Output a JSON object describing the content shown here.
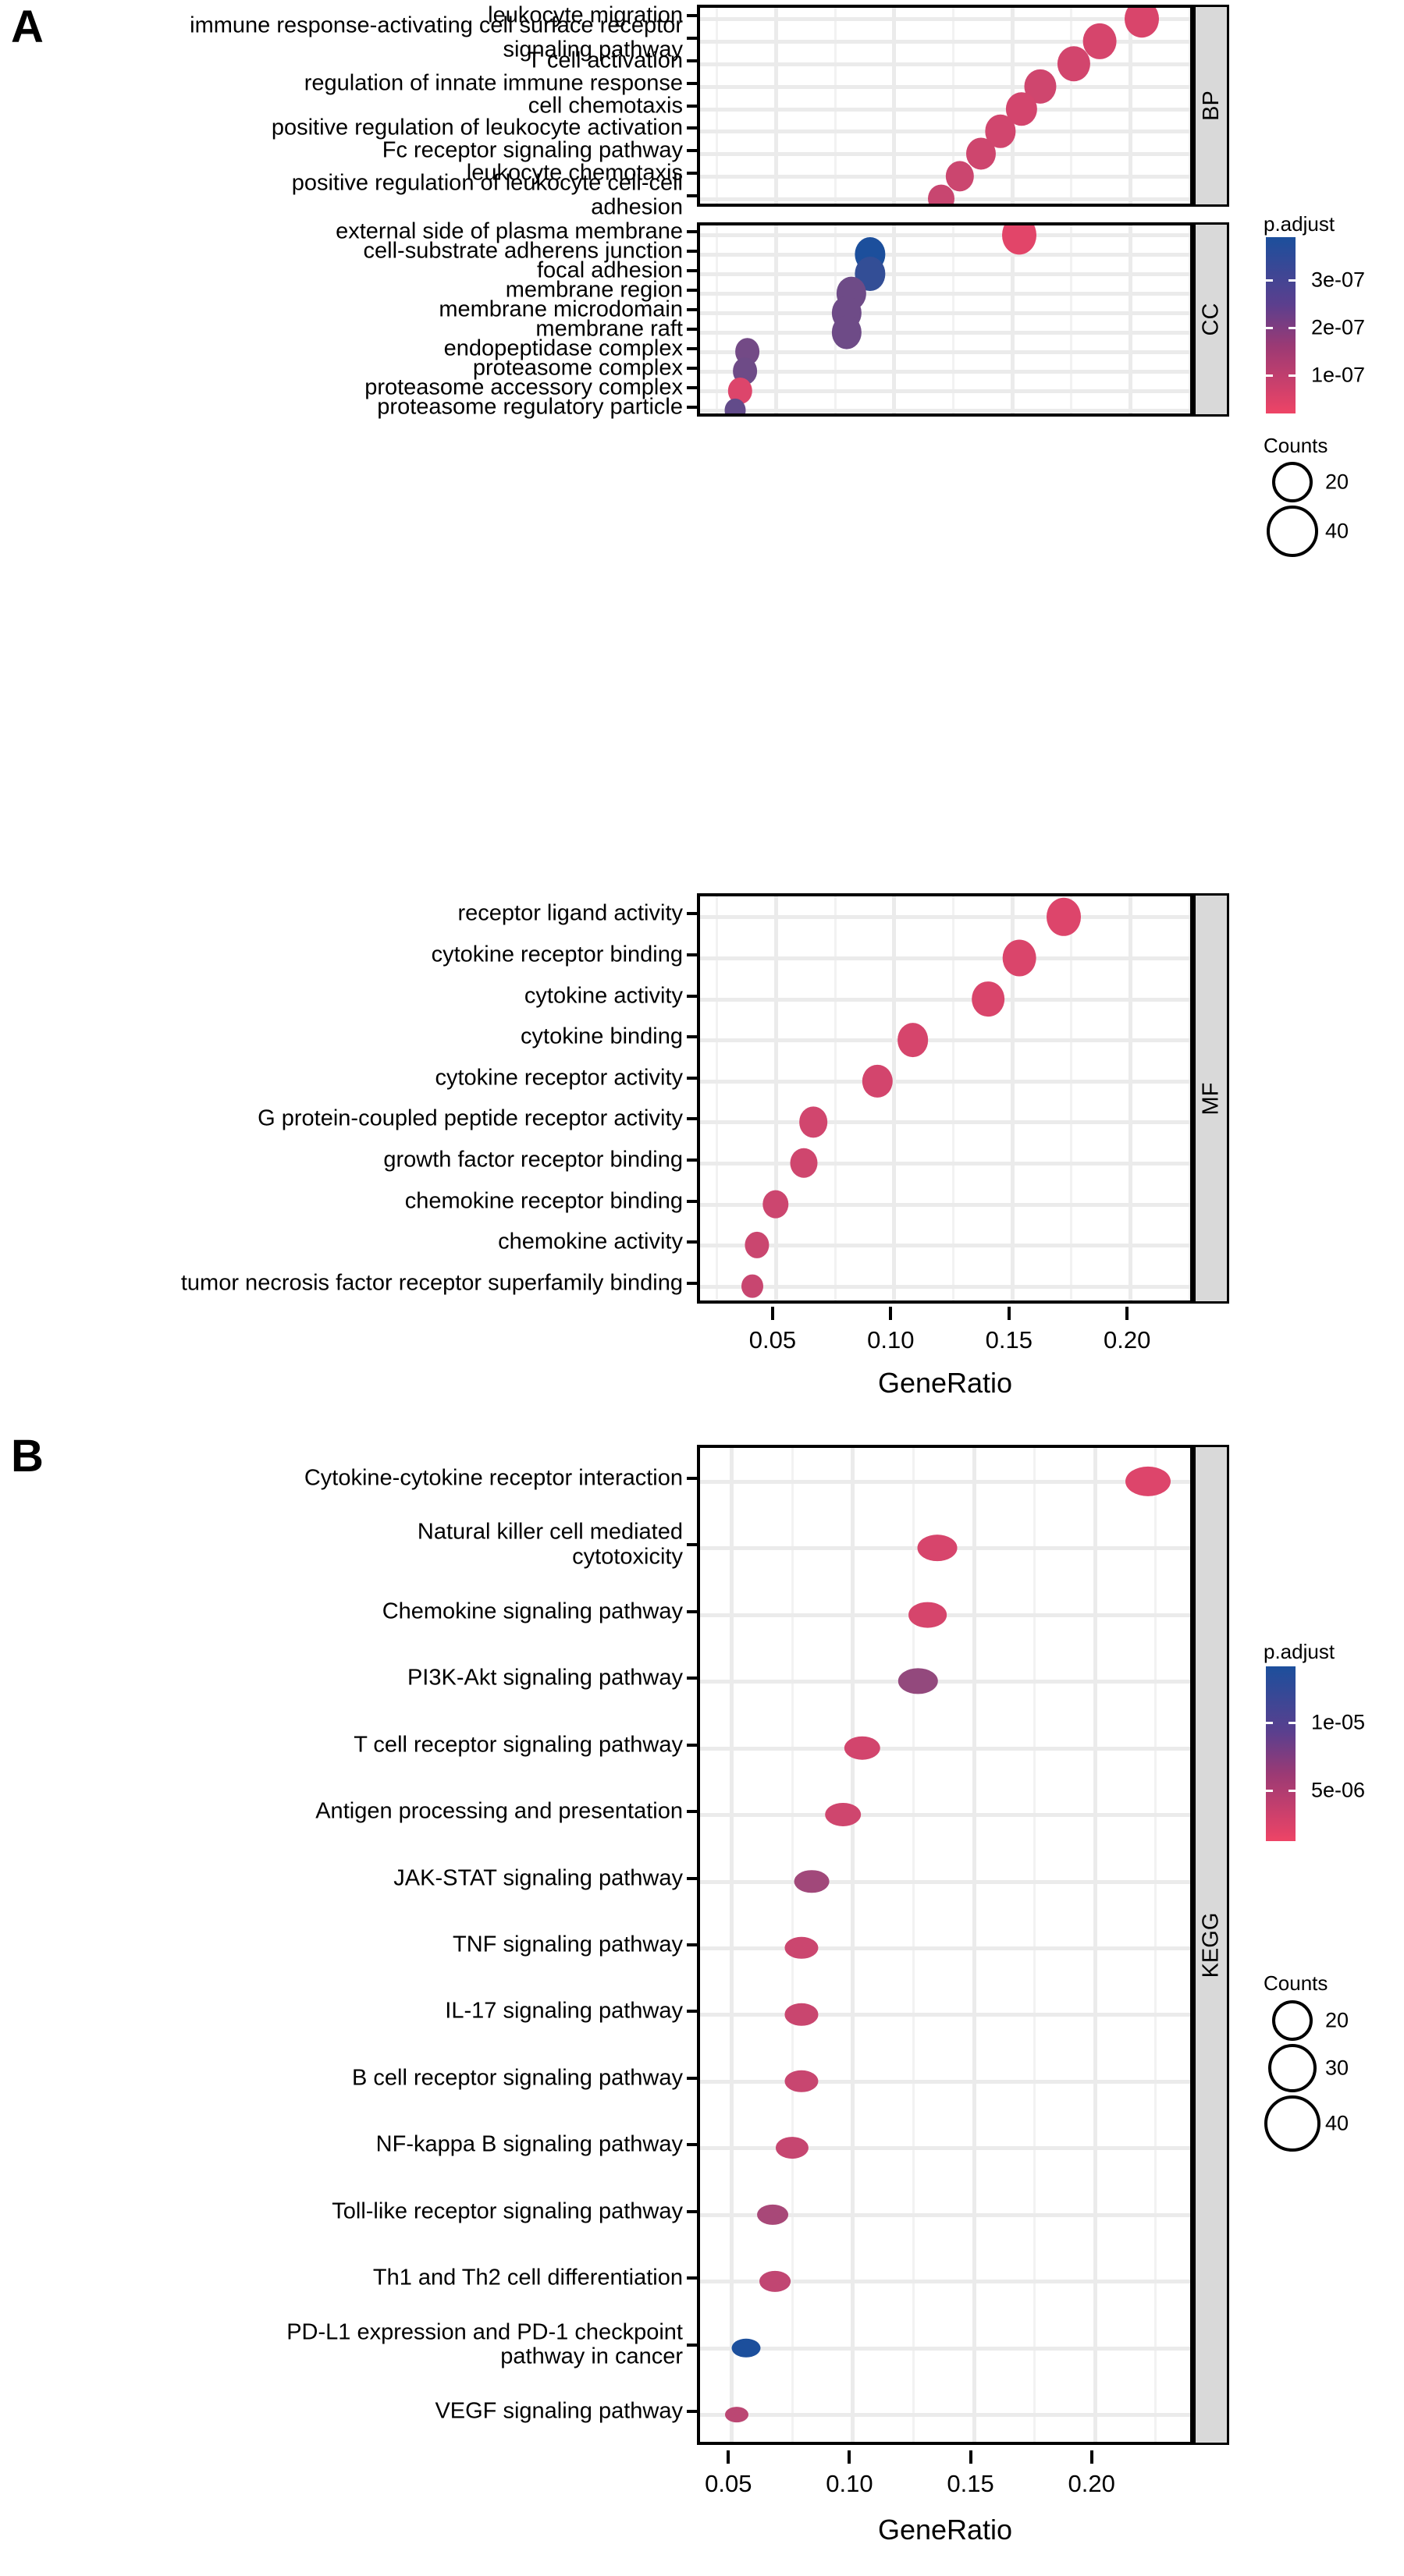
{
  "figure": {
    "panels": [
      {
        "letter": "A"
      },
      {
        "letter": "B"
      }
    ]
  },
  "panelA": {
    "letter": "A",
    "axis": {
      "xlabel": "GeneRatio",
      "xticks": [
        "0.05",
        "0.10",
        "0.15",
        "0.20"
      ],
      "xtick_values": [
        0.05,
        0.1,
        0.15,
        0.2
      ],
      "xlim": [
        0.018,
        0.228
      ]
    },
    "facets": [
      {
        "strip": "BP"
      },
      {
        "strip": "CC"
      },
      {
        "strip": "MF"
      }
    ],
    "legend": {
      "color_title": "p.adjust",
      "color_labels": [
        "3e-07",
        "2e-07",
        "1e-07"
      ],
      "color_values": [
        3e-07,
        2e-07,
        1e-07
      ],
      "color_low": "#ee4466",
      "color_high": "#1c4f9c",
      "size_title": "Counts",
      "size_labels": [
        "20",
        "40"
      ],
      "size_values": [
        20,
        40
      ]
    }
  },
  "panelB": {
    "letter": "B",
    "axis": {
      "xlabel": "GeneRatio",
      "xticks": [
        "0.05",
        "0.10",
        "0.15",
        "0.20"
      ],
      "xtick_values": [
        0.05,
        0.1,
        0.15,
        0.2
      ],
      "xlim": [
        0.037,
        0.242
      ]
    },
    "facets": [
      {
        "strip": "KEGG"
      }
    ],
    "legend": {
      "color_title": "p.adjust",
      "color_labels": [
        "1e-05",
        "5e-06"
      ],
      "color_values": [
        1e-05,
        5e-06
      ],
      "color_low": "#ee4466",
      "color_high": "#1c4f9c",
      "size_title": "Counts",
      "size_labels": [
        "20",
        "30",
        "40"
      ],
      "size_values": [
        20,
        30,
        40
      ]
    }
  },
  "chart_data": [
    {
      "type": "scatter",
      "id": "GO-BP",
      "title": "",
      "facet": "BP",
      "xlabel": "GeneRatio",
      "ylabel": "",
      "xlim": [
        0.018,
        0.228
      ],
      "grid": true,
      "color_scale": {
        "name": "p.adjust",
        "low": "#ee4466",
        "high": "#1c4f9c",
        "ticks": [
          1e-07,
          2e-07,
          3e-07
        ]
      },
      "size_scale": {
        "name": "Counts",
        "ticks": [
          20,
          40
        ]
      },
      "points": [
        {
          "label": "leukocyte migration",
          "x": 0.205,
          "count": 44,
          "p.adjust": 3e-08
        },
        {
          "label": "immune response-activating cell surface receptor\nsignaling pathway",
          "x": 0.187,
          "count": 40,
          "p.adjust": 3.5e-08
        },
        {
          "label": "T cell activation",
          "x": 0.176,
          "count": 38,
          "p.adjust": 4e-08
        },
        {
          "label": "regulation of innate immune response",
          "x": 0.162,
          "count": 35,
          "p.adjust": 4.5e-08
        },
        {
          "label": "cell chemotaxis",
          "x": 0.154,
          "count": 33,
          "p.adjust": 3.8e-08
        },
        {
          "label": "positive regulation of leukocyte activation",
          "x": 0.145,
          "count": 31,
          "p.adjust": 4.2e-08
        },
        {
          "label": "Fc receptor signaling pathway",
          "x": 0.137,
          "count": 29,
          "p.adjust": 4.6e-08
        },
        {
          "label": "leukocyte chemotaxis",
          "x": 0.128,
          "count": 27,
          "p.adjust": 5e-08
        },
        {
          "label": "positive regulation of leukocyte cell-cell\nadhesion",
          "x": 0.12,
          "count": 26,
          "p.adjust": 5.4e-08
        }
      ]
    },
    {
      "type": "scatter",
      "id": "GO-CC",
      "title": "",
      "facet": "CC",
      "xlabel": "GeneRatio",
      "ylabel": "",
      "xlim": [
        0.018,
        0.228
      ],
      "grid": true,
      "color_scale": {
        "name": "p.adjust",
        "low": "#ee4466",
        "high": "#1c4f9c",
        "ticks": [
          1e-07,
          2e-07,
          3e-07
        ]
      },
      "size_scale": {
        "name": "Counts",
        "ticks": [
          20,
          40
        ]
      },
      "points": [
        {
          "label": "external side of plasma membrane",
          "x": 0.153,
          "count": 33,
          "p.adjust": 2e-08
        },
        {
          "label": "cell-substrate adherens junction",
          "x": 0.09,
          "count": 21,
          "p.adjust": 3.6e-07
        },
        {
          "label": "focal adhesion",
          "x": 0.09,
          "count": 21,
          "p.adjust": 3.2e-07
        },
        {
          "label": "membrane region",
          "x": 0.082,
          "count": 19,
          "p.adjust": 2.2e-07
        },
        {
          "label": "membrane microdomain",
          "x": 0.08,
          "count": 19,
          "p.adjust": 2.2e-07
        },
        {
          "label": "membrane raft",
          "x": 0.08,
          "count": 19,
          "p.adjust": 2.2e-07
        },
        {
          "label": "endopeptidase complex",
          "x": 0.038,
          "count": 10,
          "p.adjust": 2.1e-07
        },
        {
          "label": "proteasome complex",
          "x": 0.037,
          "count": 10,
          "p.adjust": 2.2e-07
        },
        {
          "label": "proteasome accessory complex",
          "x": 0.035,
          "count": 9,
          "p.adjust": 3e-08
        },
        {
          "label": "proteasome regulatory particle",
          "x": 0.033,
          "count": 8,
          "p.adjust": 2.4e-07
        }
      ]
    },
    {
      "type": "scatter",
      "id": "GO-MF",
      "title": "",
      "facet": "MF",
      "xlabel": "GeneRatio",
      "ylabel": "",
      "xlim": [
        0.018,
        0.228
      ],
      "grid": true,
      "color_scale": {
        "name": "p.adjust",
        "low": "#ee4466",
        "high": "#1c4f9c",
        "ticks": [
          1e-07,
          2e-07,
          3e-07
        ]
      },
      "size_scale": {
        "name": "Counts",
        "ticks": [
          20,
          40
        ]
      },
      "points": [
        {
          "label": "receptor ligand activity",
          "x": 0.172,
          "count": 36,
          "p.adjust": 2.5e-08
        },
        {
          "label": "cytokine receptor binding",
          "x": 0.153,
          "count": 32,
          "p.adjust": 2.8e-08
        },
        {
          "label": "cytokine activity",
          "x": 0.14,
          "count": 29,
          "p.adjust": 3e-08
        },
        {
          "label": "cytokine binding",
          "x": 0.108,
          "count": 24,
          "p.adjust": 3.4e-08
        },
        {
          "label": "cytokine receptor activity",
          "x": 0.093,
          "count": 21,
          "p.adjust": 3.8e-08
        },
        {
          "label": "G protein-coupled peptide receptor activity",
          "x": 0.066,
          "count": 16,
          "p.adjust": 4.2e-08
        },
        {
          "label": "growth factor receptor binding",
          "x": 0.062,
          "count": 15,
          "p.adjust": 4.4e-08
        },
        {
          "label": "chemokine receptor binding",
          "x": 0.05,
          "count": 13,
          "p.adjust": 4.8e-08
        },
        {
          "label": "chemokine activity",
          "x": 0.042,
          "count": 11,
          "p.adjust": 5.2e-08
        },
        {
          "label": "tumor necrosis factor receptor superfamily binding",
          "x": 0.04,
          "count": 10,
          "p.adjust": 5.5e-08
        }
      ]
    },
    {
      "type": "scatter",
      "id": "KEGG",
      "title": "",
      "facet": "KEGG",
      "xlabel": "GeneRatio",
      "ylabel": "",
      "xlim": [
        0.037,
        0.242
      ],
      "grid": true,
      "color_scale": {
        "name": "p.adjust",
        "low": "#ee4466",
        "high": "#1c4f9c",
        "ticks": [
          5e-06,
          1e-05
        ]
      },
      "size_scale": {
        "name": "Counts",
        "ticks": [
          20,
          30,
          40
        ]
      },
      "points": [
        {
          "label": "Cytokine-cytokine receptor interaction",
          "x": 0.222,
          "count": 44,
          "p.adjust": 1e-06
        },
        {
          "label": "Natural killer cell mediated\ncytotoxicity",
          "x": 0.135,
          "count": 30,
          "p.adjust": 1.3e-06
        },
        {
          "label": "Chemokine signaling pathway",
          "x": 0.131,
          "count": 28,
          "p.adjust": 1.4e-06
        },
        {
          "label": "PI3K-Akt signaling pathway",
          "x": 0.127,
          "count": 29,
          "p.adjust": 5.2e-06
        },
        {
          "label": "T cell receptor signaling pathway",
          "x": 0.104,
          "count": 23,
          "p.adjust": 1.6e-06
        },
        {
          "label": "Antigen processing and presentation",
          "x": 0.096,
          "count": 22,
          "p.adjust": 1.8e-06
        },
        {
          "label": "JAK-STAT signaling pathway",
          "x": 0.083,
          "count": 21,
          "p.adjust": 4.4e-06
        },
        {
          "label": "TNF signaling pathway",
          "x": 0.079,
          "count": 19,
          "p.adjust": 2e-06
        },
        {
          "label": "IL-17 signaling pathway",
          "x": 0.079,
          "count": 19,
          "p.adjust": 2.1e-06
        },
        {
          "label": "B cell receptor signaling pathway",
          "x": 0.079,
          "count": 19,
          "p.adjust": 2.2e-06
        },
        {
          "label": "NF-kappa B signaling pathway",
          "x": 0.075,
          "count": 18,
          "p.adjust": 2.3e-06
        },
        {
          "label": "Toll-like receptor signaling pathway",
          "x": 0.067,
          "count": 16,
          "p.adjust": 4e-06
        },
        {
          "label": "Th1 and Th2 cell differentiation",
          "x": 0.068,
          "count": 16,
          "p.adjust": 2.6e-06
        },
        {
          "label": "PD-L1 expression and PD-1 checkpoint\npathway in cancer",
          "x": 0.056,
          "count": 14,
          "p.adjust": 1.2e-05
        },
        {
          "label": "VEGF signaling pathway",
          "x": 0.052,
          "count": 12,
          "p.adjust": 2.9e-06
        }
      ]
    }
  ]
}
